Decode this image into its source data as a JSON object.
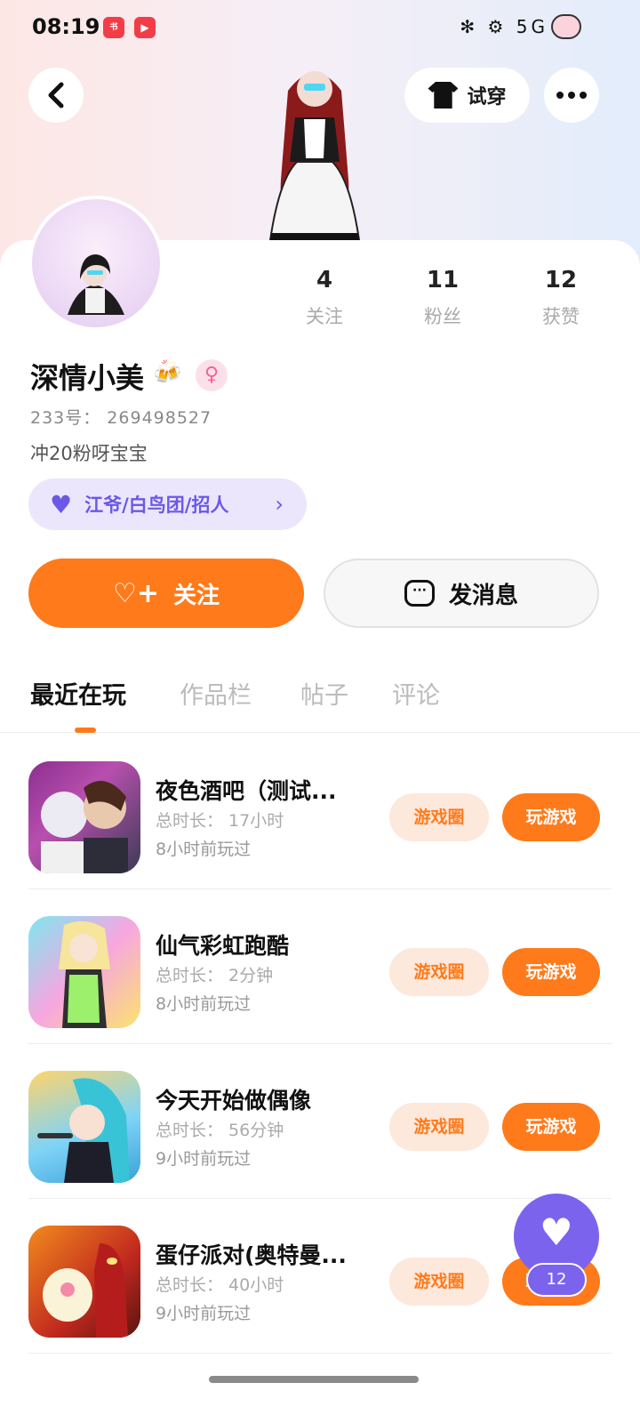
{
  "status_bar": {
    "time": "08:19",
    "badge1": "小红书",
    "badge2": "▶",
    "icons": "✻ ⚙ 5G ıll"
  },
  "header": {
    "try_on_label": "试穿",
    "back_icon": "chevron-left-icon",
    "more_icon": "more-horizontal-icon"
  },
  "stats": [
    {
      "value": "4",
      "label": "关注"
    },
    {
      "value": "11",
      "label": "粉丝"
    },
    {
      "value": "12",
      "label": "获赞"
    }
  ],
  "profile": {
    "nickname": "深情小美",
    "gender_symbol": "♀",
    "uid": "233号： 269498527",
    "bio": "冲20粉呀宝宝",
    "group_label": "江爷/白鸟团/招人"
  },
  "actions": {
    "follow_label": "关注",
    "message_label": "发消息"
  },
  "tabs": [
    {
      "label": "最近在玩",
      "active": true
    },
    {
      "label": "作品栏",
      "active": false
    },
    {
      "label": "帖子",
      "active": false
    },
    {
      "label": "评论",
      "active": false
    }
  ],
  "games": [
    {
      "title": "夜色酒吧（测试...",
      "duration": "总时长： 17小时",
      "last_played": "8小时前玩过",
      "circle_label": "游戏圈",
      "play_label": "玩游戏"
    },
    {
      "title": "仙气彩虹跑酷",
      "duration": "总时长： 2分钟",
      "last_played": "8小时前玩过",
      "circle_label": "游戏圈",
      "play_label": "玩游戏"
    },
    {
      "title": "今天开始做偶像",
      "duration": "总时长： 56分钟",
      "last_played": "9小时前玩过",
      "circle_label": "游戏圈",
      "play_label": "玩游戏"
    },
    {
      "title": "蛋仔派对(奥特曼...",
      "duration": "总时长： 40小时",
      "last_played": "9小时前玩过",
      "circle_label": "游戏圈",
      "play_label": "玩游戏"
    }
  ],
  "floating_like": {
    "count": "12"
  },
  "colors": {
    "accent": "#ff7a1a",
    "purple": "#7b63ee"
  }
}
